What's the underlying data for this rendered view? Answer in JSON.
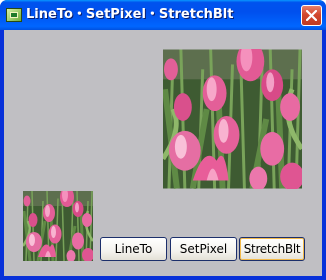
{
  "window": {
    "title": "LineTo・SetPixel・StretchBlt",
    "app_icon": "application-icon",
    "close_icon": "close-icon"
  },
  "images": {
    "large": "pink-tulips-photo",
    "small": "pink-tulips-thumbnail"
  },
  "buttons": {
    "lineto": "LineTo",
    "setpixel": "SetPixel",
    "stretchblt": "StretchBlt"
  },
  "colors": {
    "titlebar": "#0054e3",
    "client_background": "#c0bfc3",
    "close_button": "#d2472d",
    "focus_ring": "#f3ba4a"
  }
}
